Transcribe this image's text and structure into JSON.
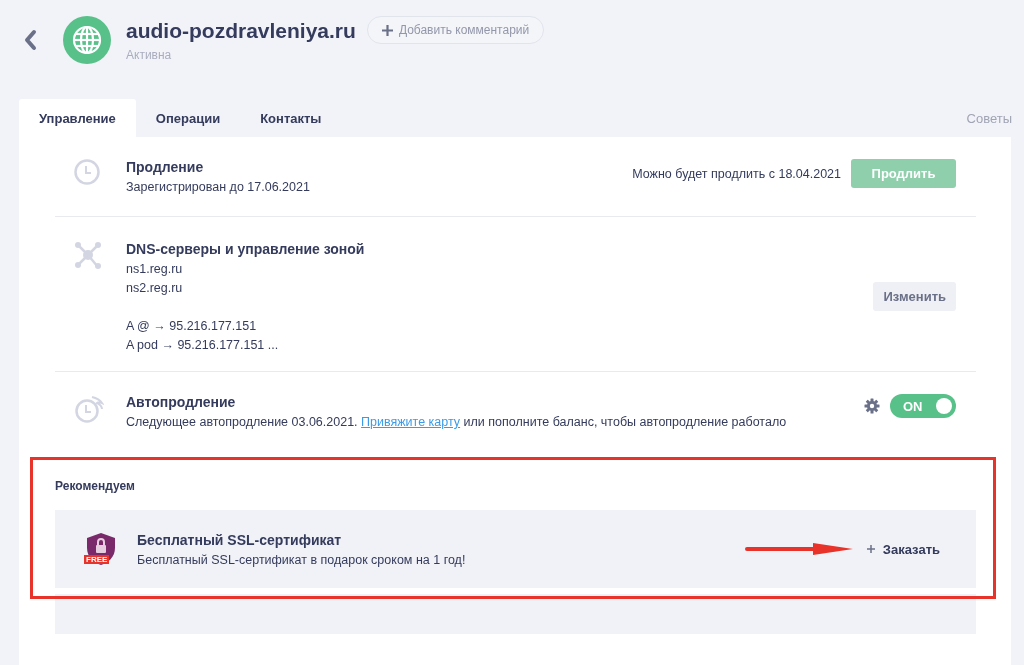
{
  "header": {
    "domain": "audio-pozdravleniya.ru",
    "status": "Активна",
    "comment_button": "Добавить комментарий"
  },
  "tabs": [
    {
      "label": "Управление",
      "selected": true
    },
    {
      "label": "Операции",
      "selected": false
    },
    {
      "label": "Контакты",
      "selected": false
    }
  ],
  "tips_link": "Советы",
  "sections": [
    {
      "kind": "renewal",
      "title": "Продление",
      "lines": [
        "Зарегистрирован до 17.06.2021"
      ],
      "note": "Можно будет продлить с 18.04.2021",
      "button": {
        "label": "Продлить",
        "disabled": true
      }
    },
    {
      "kind": "dns",
      "title": "DNS-серверы и управление зоной",
      "lines": [
        "ns1.reg.ru",
        "ns2.reg.ru"
      ],
      "records": [
        "A @ → 95.216.177.151",
        "A pod → 95.216.177.151 ..."
      ],
      "button": {
        "label": "Изменить"
      }
    },
    {
      "kind": "autorenew",
      "title": "Автопродление",
      "text_before": "Следующее автопродление 03.06.2021.",
      "link": "Привяжите карту",
      "text_after": "или пополните баланс, чтобы автопродление работало",
      "toggle": {
        "label": "ON",
        "on": true
      }
    }
  ],
  "recommend": {
    "heading": "Рекомендуем",
    "items": [
      {
        "title": "Бесплатный SSL-сертификат",
        "description": "Бесплатный SSL-сертификат в подарок сроком на 1 год!",
        "badge": "FREE",
        "action": "Заказать"
      }
    ]
  }
}
